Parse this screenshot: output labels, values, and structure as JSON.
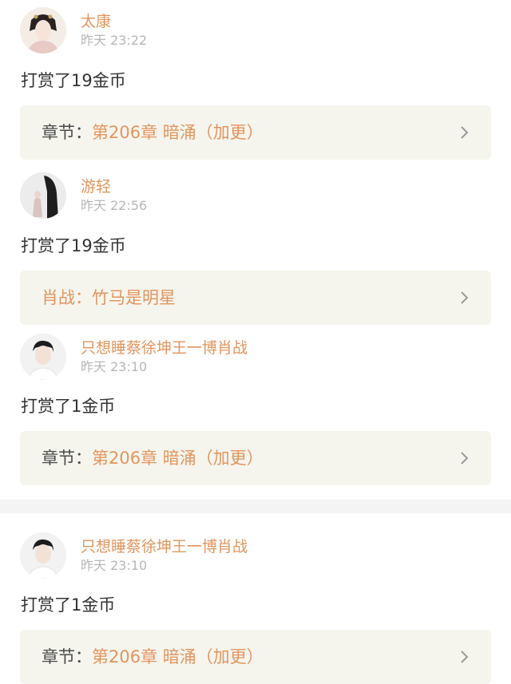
{
  "items": [
    {
      "name": "太康",
      "time": "昨天 23:22",
      "message": "打赏了19金币",
      "card_label": "章节：",
      "card_value": "第206章 暗涌（加更）",
      "avatar": "woman-hanfu-avatar"
    },
    {
      "name": "游轻",
      "time": "昨天 22:56",
      "message": "打赏了19金币",
      "card_label": "",
      "card_value": "肖战：竹马是明星",
      "avatar": "dark-figure-avatar"
    },
    {
      "name": "只想睡蔡徐坤王一博肖战",
      "time": "昨天 23:10",
      "message": "打赏了1金币",
      "card_label": "章节：",
      "card_value": "第206章 暗涌（加更）",
      "avatar": "young-man-avatar"
    },
    {
      "name": "只想睡蔡徐坤王一博肖战",
      "time": "昨天 23:10",
      "message": "打赏了1金币",
      "card_label": "章节：",
      "card_value": "第206章 暗涌（加更）",
      "avatar": "young-man-avatar"
    }
  ],
  "colors": {
    "accent": "#e3955e",
    "card_bg": "#f5f5ee",
    "time": "#b7b7b7",
    "text": "#333333"
  }
}
